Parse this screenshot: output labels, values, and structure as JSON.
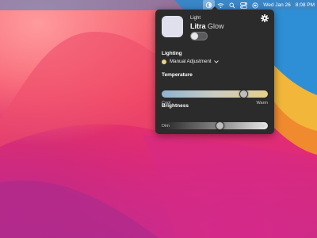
{
  "menubar": {
    "date": "Wed Jan 26",
    "time": "8:08 PM",
    "icons": [
      "litra-icon",
      "wifi-icon",
      "search-icon",
      "control-center-icon",
      "siri-icon"
    ]
  },
  "device": {
    "type_label": "Light",
    "name_bold": "Litra",
    "name_light": "Glow",
    "power_on": false
  },
  "lighting": {
    "title": "Lighting",
    "mode": "Manual Adjustment"
  },
  "temperature": {
    "title": "Temperature",
    "min_label": "Cool",
    "max_label": "Warm",
    "level": 0.8
  },
  "brightness": {
    "title": "Brightness",
    "min_label": "Dim",
    "max_label": "Bright",
    "level": 0.55
  },
  "colors": {
    "popover_bg": "#2b2b2c",
    "warm_dot": "#e7d38a"
  }
}
